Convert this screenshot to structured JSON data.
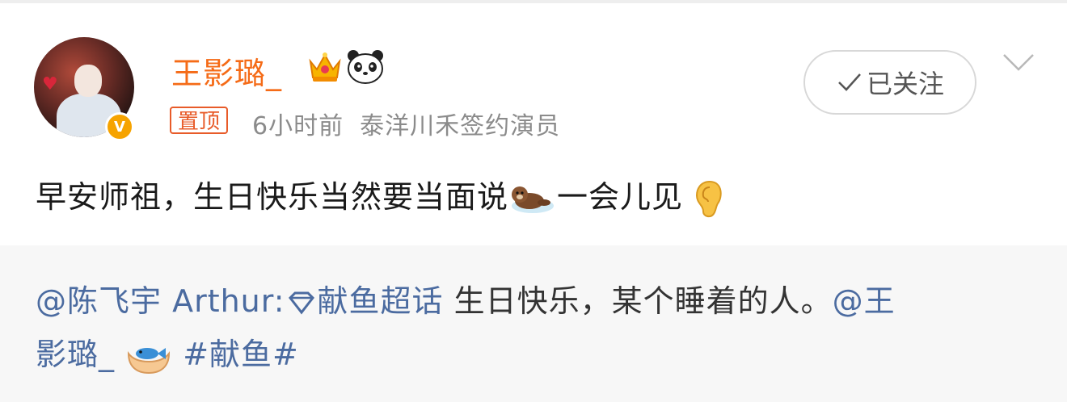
{
  "post": {
    "username": "王影璐_",
    "pin_label": "置顶",
    "time": "6小时前",
    "source": "泰洋川禾签约演员",
    "follow_button": "已关注",
    "text_part1": "早安师祖，生日快乐当然要当面说",
    "text_part2": "一会儿见"
  },
  "repost": {
    "author_mention": "@陈飞宇 Arthur:",
    "topic": "献鱼超话",
    "text": " 生日快乐，某个睡着的人。",
    "mention2_line1": "@王",
    "mention2_line2": "影璐_",
    "hashtag": "#献鱼#"
  },
  "icons": {
    "crown": "crown-badge-icon",
    "panda": "panda-icon",
    "verified": "verified-v-icon",
    "check": "check-icon",
    "chevron": "chevron-down-icon",
    "otter": "otter-emoji-icon",
    "ear": "ear-emoji-icon",
    "diamond": "supertopic-diamond-icon",
    "hands_fish": "hands-fish-emoji-icon"
  },
  "colors": {
    "username": "#f56b17",
    "pin": "#e85b29",
    "link": "#4b6ba0",
    "meta": "#8b8b8b",
    "repost_bg": "#f7f7f7"
  }
}
